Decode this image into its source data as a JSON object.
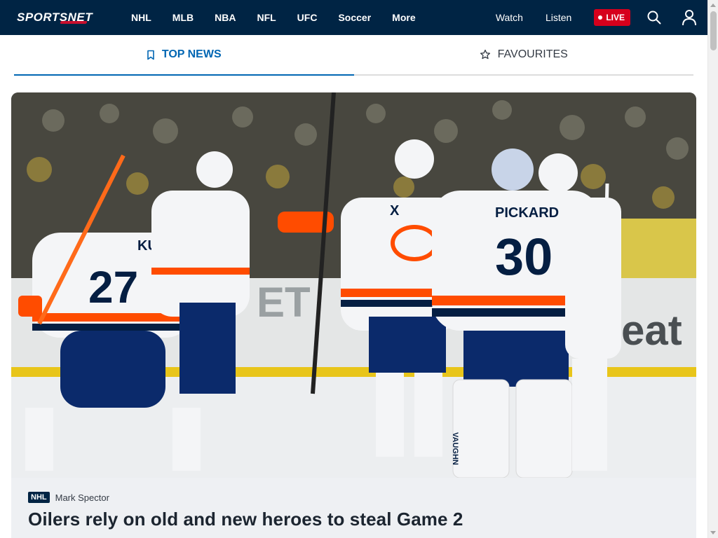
{
  "brand": {
    "logo_text": "SPORTSNET"
  },
  "nav": {
    "items": [
      {
        "label": "NHL"
      },
      {
        "label": "MLB"
      },
      {
        "label": "NBA"
      },
      {
        "label": "NFL"
      },
      {
        "label": "UFC"
      },
      {
        "label": "Soccer"
      },
      {
        "label": "More"
      }
    ],
    "watch_label": "Watch",
    "listen_label": "Listen",
    "live_label": "LIVE",
    "search_icon": "search-icon",
    "profile_icon": "user-icon"
  },
  "tabs": [
    {
      "label": "TOP NEWS",
      "icon": "bookmark-icon",
      "active": true
    },
    {
      "label": "FAVOURITES",
      "icon": "star-icon",
      "active": false
    }
  ],
  "hero": {
    "league": "NHL",
    "author": "Mark Spector",
    "headline": "Oilers rely on old and new heroes to steal Game 2",
    "image_jerseys": {
      "left_name": "KULAK",
      "left_number": "27",
      "right_name": "PICKARD",
      "right_number": "30",
      "pad_brand": "VAUGHN",
      "captain_mark": "C",
      "letter_x": "X"
    }
  },
  "colors": {
    "nav_bg": "#002444",
    "accent_blue": "#0066b3",
    "live_red": "#d6001c",
    "oilers_orange": "#ff4c00",
    "oilers_navy": "#041e42"
  }
}
